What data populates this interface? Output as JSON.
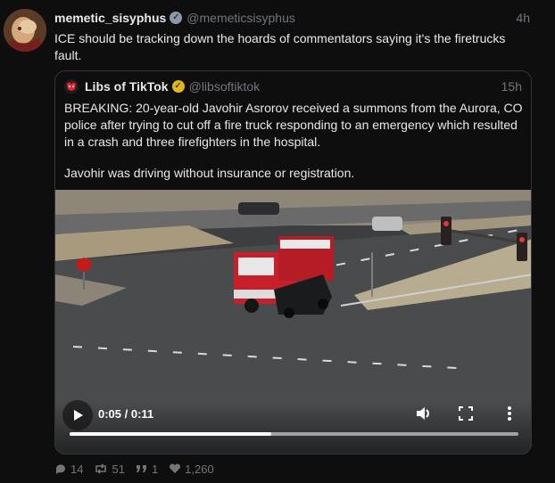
{
  "tweet": {
    "author_name": "memetic_sisyphus",
    "author_handle": "@memeticsisyphus",
    "timestamp": "4h",
    "text": "ICE should be tracking down the hoards of commentators saying it's the firetrucks fault."
  },
  "quote": {
    "author_name": "Libs of TikTok",
    "author_handle": "@libsoftiktok",
    "timestamp": "15h",
    "paragraph_1": "BREAKING: 20-year-old Javohir Asrorov received a summons from the Aurora, CO police after trying to cut off a fire truck responding to an emergency which resulted in a crash and three firefighters in the hospital.",
    "paragraph_2": "Javohir was driving without insurance or registration.",
    "video": {
      "time_display": "0:05 / 0:11",
      "progress": 0.45
    }
  },
  "actions": {
    "replies": "14",
    "reposts": "51",
    "quotes": "1",
    "likes": "1,260"
  },
  "colors": {
    "background": "#0e0e0f",
    "muted": "#71767b",
    "verified_gold": "#e2b719",
    "fire_truck_red": "#c8202a"
  },
  "icons": [
    "verified-badge-icon",
    "gold-verified-badge-icon",
    "play-icon",
    "volume-icon",
    "fullscreen-icon",
    "more-icon",
    "reply-icon",
    "repost-icon",
    "quote-icon",
    "like-icon"
  ]
}
